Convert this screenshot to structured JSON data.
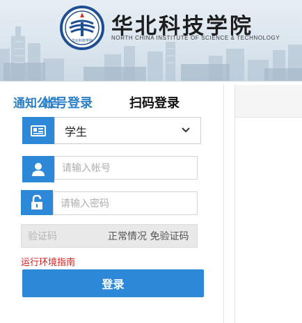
{
  "header": {
    "school_name": "华北科技学院",
    "school_name_en": "NORTH CHINA INSTITUTE OF SCIENCE & TECHNOLOGY",
    "logo_text": "华北科技学院"
  },
  "login": {
    "tab_account": "帐号登录",
    "tab_qr": "扫码登录",
    "role_selected": "学生",
    "account_placeholder": "请输入帐号",
    "password_placeholder": "请输入密码",
    "captcha_placeholder": "验证码",
    "captcha_hint": "正常情况 免验证码",
    "guide_link": "运行环境指南",
    "login_button": "登录"
  },
  "notice": {
    "title": "通知公告"
  },
  "colors": {
    "accent": "#2d89d8",
    "tab_active": "#2b80c8",
    "link_red": "#d21b1b"
  },
  "icons": {
    "role": "id-card-icon",
    "account": "user-icon",
    "password": "lock-icon",
    "dropdown": "chevron-down-icon"
  }
}
